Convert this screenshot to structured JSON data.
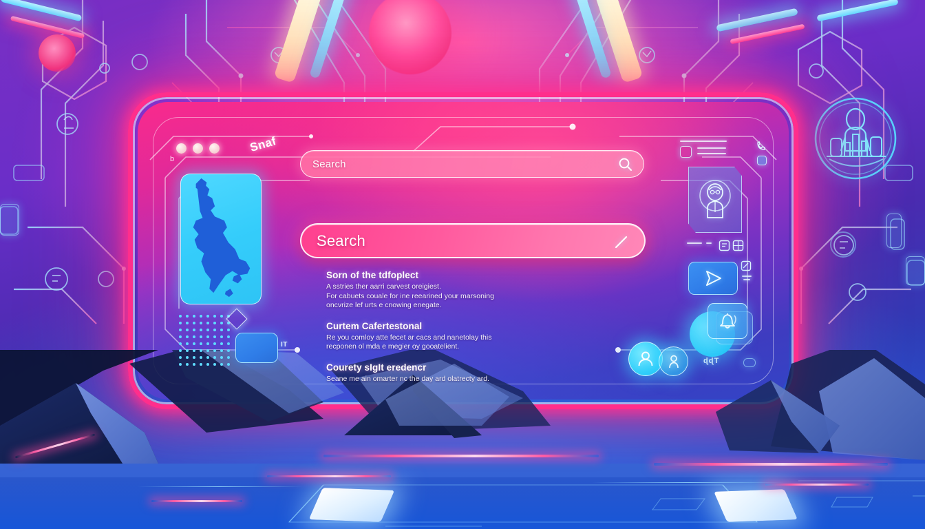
{
  "scene": {
    "theme": "neon-cyberpunk-search-interface",
    "accent_pink": "#ff2e8c",
    "accent_cyan": "#35cdfb",
    "accent_blue": "#2f7de8",
    "panel_bg_start": "#f92a8c",
    "panel_bg_end": "#3344c6"
  },
  "window": {
    "tag": "b",
    "brand_label": "Snaf",
    "dots": [
      "dot-1",
      "dot-2",
      "dot-3"
    ]
  },
  "search_top": {
    "placeholder": "Search",
    "icon": "search-icon"
  },
  "search_main": {
    "placeholder": "Search",
    "icon": "pencil-icon"
  },
  "content": {
    "sections": [
      {
        "title": "Sorn of the tdfoplect",
        "lines": [
          "A sstries ther aarri carvest oreigiest.",
          "For cabuets couale for ine reearined your marsoning",
          "oncvrize lef urts e cnowing enegate."
        ]
      },
      {
        "title": "Curtem Cafertestonal",
        "lines": [
          "Re you comloy atte fecet ar cacs and nanetolay this",
          "recponen ol mda e megier oy gooatelient."
        ]
      },
      {
        "title": "Courety sIgIt eredencr",
        "lines": [
          "Seane me ain omarter nc the day ard olatrecty ard."
        ]
      }
    ]
  },
  "left_widgets": {
    "map_card": {
      "name": "map-card",
      "shape": "island-landmass"
    },
    "dot_grid": {
      "name": "dot-matrix",
      "rows": 8,
      "cols": 9
    },
    "diamond": {
      "name": "diamond-outline"
    },
    "blue_card": {
      "name": "blue-card"
    },
    "it_tag": "IT"
  },
  "right_widgets": {
    "avatar_card": {
      "icon": "user-avatar-icon"
    },
    "play_card": {
      "icon": "send-arrow-icon"
    },
    "bell_card": {
      "icon": "bell-icon"
    },
    "user_bubbles": [
      {
        "icon": "user-icon"
      },
      {
        "icon": "user-icon"
      }
    ],
    "glyph_label": "ɖɖТ",
    "emblem": {
      "icon": "person-city-emblem-icon"
    }
  }
}
